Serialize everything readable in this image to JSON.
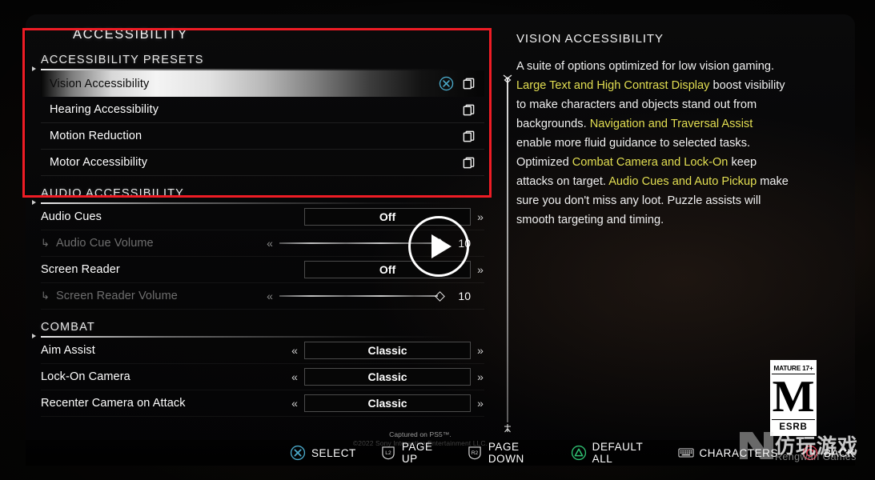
{
  "page_title": "ACCESSIBILITY",
  "sections": [
    {
      "heading": "ACCESSIBILITY PRESETS",
      "rows": [
        {
          "label": "Vision Accessibility",
          "selected": true,
          "has_select_icon": true,
          "copy_icon": "copy-icon"
        },
        {
          "label": "Hearing Accessibility",
          "selected": false,
          "has_select_icon": false,
          "copy_icon": "copy-icon"
        },
        {
          "label": "Motion Reduction",
          "selected": false,
          "has_select_icon": false,
          "copy_icon": "copy-icon"
        },
        {
          "label": "Motor Accessibility",
          "selected": false,
          "has_select_icon": false,
          "copy_icon": "copy-icon"
        }
      ]
    },
    {
      "heading": "AUDIO ACCESSIBILITY",
      "rows": [
        {
          "label": "Audio Cues",
          "type": "option",
          "value": "Off",
          "dim": false,
          "sub": false,
          "left_arrow": false,
          "right_arrow": "»"
        },
        {
          "label": "Audio Cue Volume",
          "type": "slider",
          "value": "10",
          "dim": true,
          "sub": true,
          "left_arrow": "«",
          "right_arrow": false
        },
        {
          "label": "Screen Reader",
          "type": "option",
          "value": "Off",
          "dim": false,
          "sub": false,
          "left_arrow": false,
          "right_arrow": "»"
        },
        {
          "label": "Screen Reader Volume",
          "type": "slider",
          "value": "10",
          "dim": true,
          "sub": true,
          "left_arrow": "«",
          "right_arrow": false
        }
      ]
    },
    {
      "heading": "COMBAT",
      "rows": [
        {
          "label": "Aim Assist",
          "type": "option",
          "value": "Classic",
          "dim": false,
          "sub": false,
          "left_arrow": "«",
          "right_arrow": "»"
        },
        {
          "label": "Lock-On Camera",
          "type": "option",
          "value": "Classic",
          "dim": false,
          "sub": false,
          "left_arrow": "«",
          "right_arrow": "»"
        },
        {
          "label": "Recenter Camera on Attack",
          "type": "option",
          "value": "Classic",
          "dim": false,
          "sub": false,
          "left_arrow": "«",
          "right_arrow": "»"
        }
      ]
    }
  ],
  "description": {
    "title": "VISION ACCESSIBILITY",
    "parts": [
      {
        "text": "A suite of options optimized for low vision gaming. ",
        "highlight": false
      },
      {
        "text": "Large Text and High Contrast Display",
        "highlight": true
      },
      {
        "text": " boost visibility to make characters and objects stand out from backgrounds. ",
        "highlight": false
      },
      {
        "text": "Navigation and Traversal Assist",
        "highlight": true
      },
      {
        "text": " enable more fluid guidance to selected tasks. Optimized ",
        "highlight": false
      },
      {
        "text": "Combat Camera and Lock-On",
        "highlight": true
      },
      {
        "text": " keep attacks on target. ",
        "highlight": false
      },
      {
        "text": "Audio Cues and Auto Pickup",
        "highlight": true
      },
      {
        "text": " make sure you don't miss any loot. Puzzle assists will smooth targeting and timing.",
        "highlight": false
      }
    ]
  },
  "captured": {
    "line1": "Captured on PS5™.",
    "line2": "©2022 Sony Interactive Entertainment LLC."
  },
  "esrb": {
    "top": "MATURE 17+",
    "letter": "M",
    "bottom": "ESRB"
  },
  "footer": [
    {
      "label": "SELECT",
      "icon": "ps-cross-icon"
    },
    {
      "label": "PAGE UP",
      "icon": "l2-trigger-icon"
    },
    {
      "label": "PAGE DOWN",
      "icon": "r2-trigger-icon"
    },
    {
      "label": "DEFAULT ALL",
      "icon": "ps-triangle-icon"
    },
    {
      "label": "CHARACTERS",
      "icon": "keyboard-icon"
    },
    {
      "label": "BACK",
      "icon": "ps-circle-icon"
    }
  ],
  "watermark": {
    "cn": "仿玩游戏",
    "en": "Rengwan Games"
  },
  "colors": {
    "highlight_yellow": "#e3df52",
    "annotation_red": "#ee1c25",
    "cross_blue": "#4aa8c8",
    "triangle_green": "#2fbf71",
    "circle_red": "#d43b4e"
  },
  "overlay": {
    "play_button": "play-icon"
  }
}
